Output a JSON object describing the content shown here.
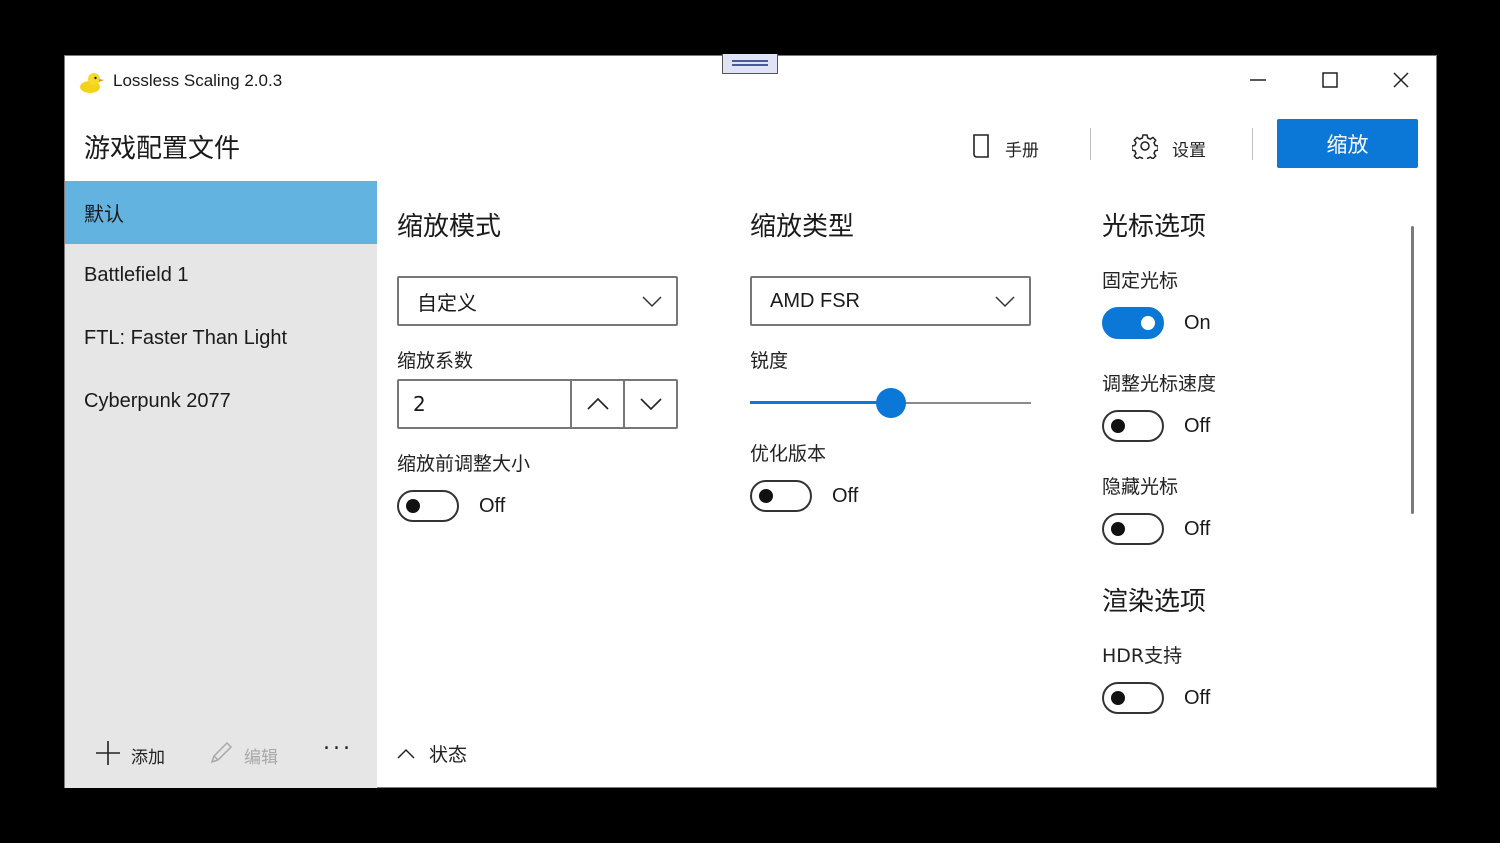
{
  "window": {
    "title": "Lossless Scaling 2.0.3",
    "icon": "duck-icon",
    "controls": {
      "minimize": "minimize-icon",
      "maximize": "maximize-icon",
      "close": "close-icon"
    }
  },
  "header": {
    "page_title": "游戏配置文件",
    "manual_label": "手册",
    "settings_label": "设置",
    "scale_button_label": "缩放"
  },
  "sidebar": {
    "profiles": [
      {
        "label": "默认",
        "selected": true
      },
      {
        "label": "Battlefield 1",
        "selected": false
      },
      {
        "label": "FTL: Faster Than Light",
        "selected": false
      },
      {
        "label": "Cyberpunk 2077",
        "selected": false
      }
    ],
    "add_label": "添加",
    "edit_label": "编辑",
    "more_label": "..."
  },
  "status": {
    "label": "状态"
  },
  "scaling_mode": {
    "title": "缩放模式",
    "mode_value": "自定义",
    "factor_label": "缩放系数",
    "factor_value": "2",
    "resize_before_label": "缩放前调整大小",
    "resize_before_state": "Off"
  },
  "scaling_type": {
    "title": "缩放类型",
    "type_value": "AMD FSR",
    "sharpness_label": "锐度",
    "sharpness_fraction": 0.5,
    "optimized_label": "优化版本",
    "optimized_state": "Off"
  },
  "cursor_options": {
    "title": "光标选项",
    "clip_cursor_label": "固定光标",
    "clip_cursor_state": "On",
    "adjust_speed_label": "调整光标速度",
    "adjust_speed_state": "Off",
    "hide_cursor_label": "隐藏光标",
    "hide_cursor_state": "Off"
  },
  "render_options": {
    "title": "渲染选项",
    "hdr_label": "HDR支持",
    "hdr_state": "Off"
  },
  "colors": {
    "accent": "#0b78d7",
    "selected_profile": "#63b3e0",
    "sidebar_bg": "#e6e6e6"
  }
}
